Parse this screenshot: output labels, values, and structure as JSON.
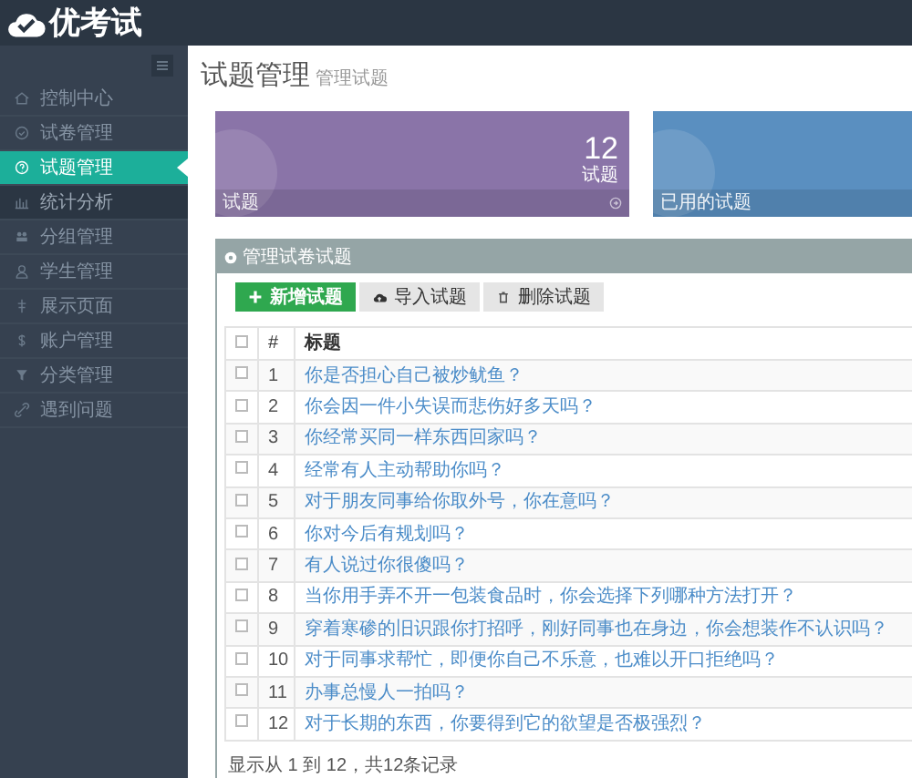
{
  "brand": "优考试",
  "sidebar": {
    "items": [
      {
        "label": "控制中心",
        "selected": false,
        "highlighted": false
      },
      {
        "label": "试卷管理",
        "selected": false,
        "highlighted": false
      },
      {
        "label": "试题管理",
        "selected": true,
        "highlighted": false
      },
      {
        "label": "统计分析",
        "selected": false,
        "highlighted": true
      },
      {
        "label": "分组管理",
        "selected": false,
        "highlighted": false
      },
      {
        "label": "学生管理",
        "selected": false,
        "highlighted": false
      },
      {
        "label": "展示页面",
        "selected": false,
        "highlighted": false
      },
      {
        "label": "账户管理",
        "selected": false,
        "highlighted": false
      },
      {
        "label": "分类管理",
        "selected": false,
        "highlighted": false
      },
      {
        "label": "遇到问题",
        "selected": false,
        "highlighted": false
      }
    ]
  },
  "page": {
    "title": "试题管理",
    "subtitle": "管理试题"
  },
  "stat_cards": [
    {
      "count": "12",
      "unit": "试题",
      "footer": "试题",
      "color": "#8a74a8"
    },
    {
      "footer": "已用的试题",
      "color": "#5a8fc0"
    }
  ],
  "panel": {
    "title": "管理试卷试题",
    "buttons": [
      {
        "label": "新增试题",
        "kind": "primary"
      },
      {
        "label": "导入试题",
        "kind": "import"
      },
      {
        "label": "删除试题",
        "kind": "delete"
      }
    ],
    "table": {
      "columns": [
        "#",
        "标题"
      ],
      "all_checked": false,
      "rows": [
        {
          "number": "1",
          "title": "你是否担心自己被炒鱿鱼？",
          "checked": false
        },
        {
          "number": "2",
          "title": "你会因一件小失误而悲伤好多天吗？",
          "checked": false
        },
        {
          "number": "3",
          "title": "你经常买同一样东西回家吗？",
          "checked": false
        },
        {
          "number": "4",
          "title": "经常有人主动帮助你吗？",
          "checked": false
        },
        {
          "number": "5",
          "title": "对于朋友同事给你取外号，你在意吗？",
          "checked": false
        },
        {
          "number": "6",
          "title": "你对今后有规划吗？",
          "checked": false
        },
        {
          "number": "7",
          "title": "有人说过你很傻吗？",
          "checked": false
        },
        {
          "number": "8",
          "title": "当你用手弄不开一包装食品时，你会选择下列哪种方法打开？",
          "checked": false
        },
        {
          "number": "9",
          "title": "穿着寒碜的旧识跟你打招呼，刚好同事也在身边，你会想装作不认识吗？",
          "checked": false
        },
        {
          "number": "10",
          "title": "对于同事求帮忙，即便你自己不乐意，也难以开口拒绝吗？",
          "checked": false
        },
        {
          "number": "11",
          "title": "办事总慢人一拍吗？",
          "checked": false
        },
        {
          "number": "12",
          "title": "对于长期的东西，你要得到它的欲望是否极强烈？",
          "checked": false
        }
      ]
    },
    "footer": "显示从 1 到 12，共12条记录"
  }
}
